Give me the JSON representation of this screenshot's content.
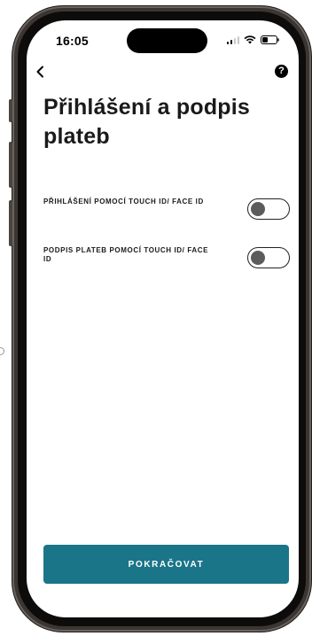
{
  "status_bar": {
    "time": "16:05"
  },
  "icons": {
    "back": "chevron-left-icon",
    "help": "question-circle-icon",
    "help_glyph": "?",
    "signal": "cellular-signal-icon",
    "wifi": "wifi-icon",
    "battery": "battery-icon"
  },
  "header": {
    "title": "Přihlášení a podpis plateb"
  },
  "settings": [
    {
      "label": "PŘIHLÁŠENÍ POMOCÍ TOUCH ID/ FACE ID",
      "enabled": false
    },
    {
      "label": "PODPIS PLATEB POMOCÍ TOUCH ID/ FACE ID",
      "enabled": false
    }
  ],
  "actions": {
    "continue_label": "POKRAČOVAT"
  },
  "colors": {
    "primary_button": "#1b7588",
    "toggle_off_knob": "#5c5c5c",
    "text": "#1a1a1a"
  }
}
